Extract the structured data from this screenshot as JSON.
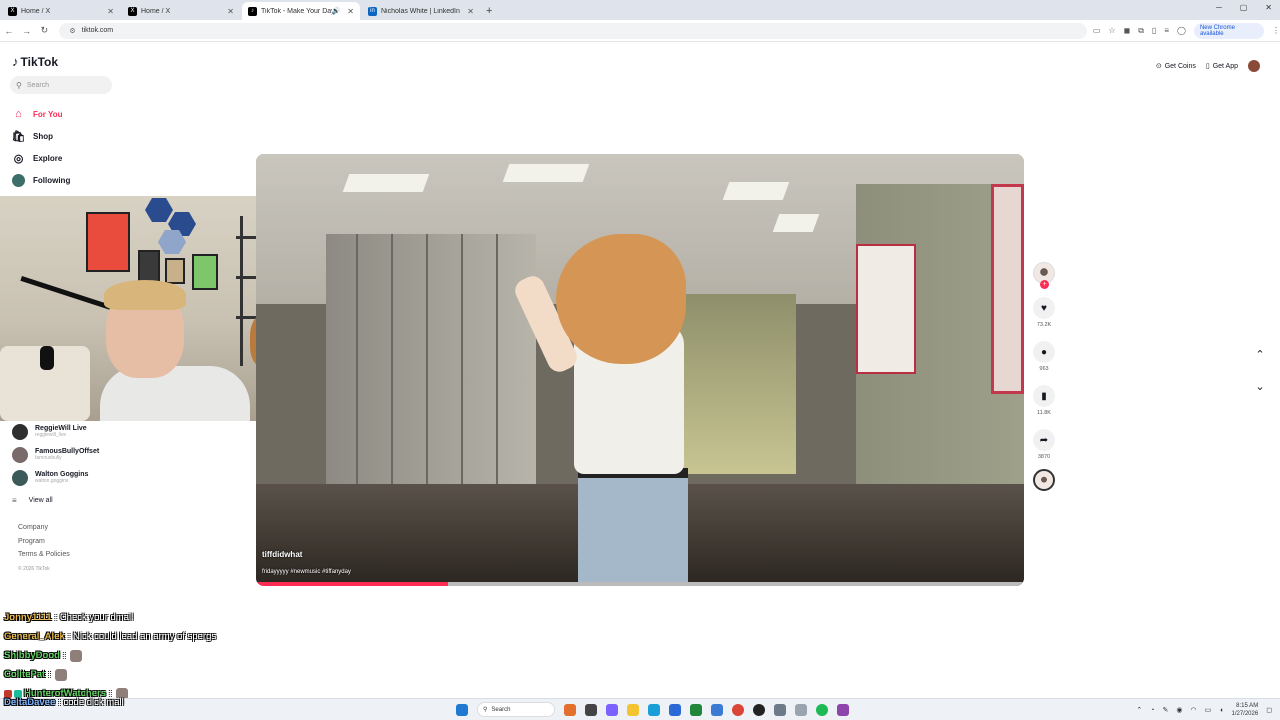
{
  "browser": {
    "tabs": [
      {
        "title": "Home / X",
        "favicon": "x-logo-icon"
      },
      {
        "title": "Home / X",
        "favicon": "x-logo-icon"
      },
      {
        "title": "TikTok - Make Your Day",
        "favicon": "tiktok-icon",
        "active": true
      },
      {
        "title": "Nicholas White | LinkedIn",
        "favicon": "linkedin-icon"
      }
    ],
    "url": "tiktok.com",
    "update_label": "New Chrome available"
  },
  "tiktok": {
    "logo_text": "TikTok",
    "search_placeholder": "Search",
    "nav": [
      {
        "label": "For You",
        "icon": "home-icon"
      },
      {
        "label": "Shop",
        "icon": "shop-icon"
      },
      {
        "label": "Explore",
        "icon": "compass-icon"
      },
      {
        "label": "Following",
        "icon": "avatar-icon"
      }
    ],
    "following_accounts": [
      {
        "name": "ReggieWill Live",
        "handle": "reggiewill_live"
      },
      {
        "name": "FamousBullyOffset",
        "handle": "famousbully"
      },
      {
        "name": "Walton Goggins",
        "handle": "walton.goggins"
      }
    ],
    "view_all": "View all",
    "footer": [
      "Company",
      "Program",
      "Terms & Policies"
    ],
    "copyright": "© 2026 TikTok",
    "topright": {
      "get_coins": "Get Coins",
      "get_app": "Get App"
    }
  },
  "video": {
    "author": "tiffdidwhat",
    "caption": "fridayyyyy #newmusic #tiffanyday",
    "progress": 0.25,
    "likes": "73.2K",
    "comments": "963",
    "saves": "11.8K",
    "shares": "3870"
  },
  "chat": [
    {
      "user": "Jonny1111",
      "color": "#e8b84a",
      "message": ": Check your dmail"
    },
    {
      "user": "General_Alek",
      "color": "#e8b84a",
      "message": ": Nick could lead an army of spergs"
    },
    {
      "user": "ShibbyDood",
      "color": "#5fd35f",
      "message": ":"
    },
    {
      "user": "ColitePat",
      "color": "#5fd35f",
      "message": ":"
    },
    {
      "user": "HunterofWatchers",
      "color": "#5fd35f",
      "message": ":"
    },
    {
      "user": "DeltaDavee",
      "color": "#7ab4ff",
      "message": ": code dick mail"
    }
  ],
  "taskbar": {
    "search_label": "Search",
    "time": "8:15 AM",
    "date": "1/27/2026"
  }
}
